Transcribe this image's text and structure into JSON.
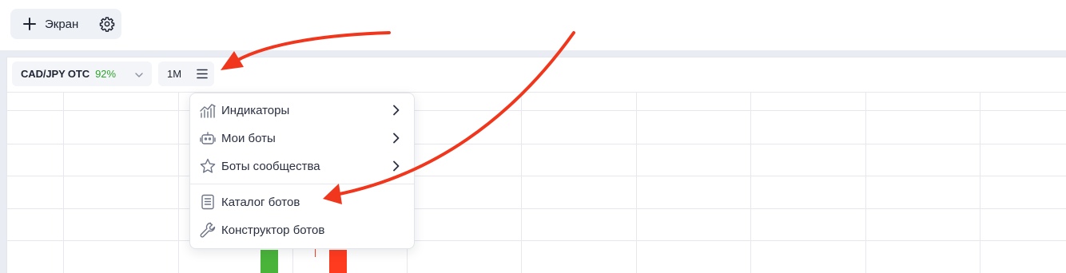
{
  "top": {
    "screen_button_label": "Экран",
    "icons": [
      "plus-icon",
      "gear-icon"
    ]
  },
  "toolbar": {
    "asset_name": "CAD/JPY OTC",
    "asset_payout": "92%",
    "timeframe": "1M"
  },
  "menu": {
    "items": [
      {
        "label": "Индикаторы",
        "icon": "indicators-icon",
        "has_submenu": true
      },
      {
        "label": "Мои боты",
        "icon": "robot-icon",
        "has_submenu": true
      },
      {
        "label": "Боты сообщества",
        "icon": "star-icon",
        "has_submenu": true
      },
      {
        "label": "Каталог ботов",
        "icon": "book-icon",
        "has_submenu": false
      },
      {
        "label": "Конструктор ботов",
        "icon": "wrench-icon",
        "has_submenu": false
      }
    ]
  },
  "colors": {
    "accent_green": "#2ea32e",
    "candle_up": "#49b33a",
    "candle_down": "#ff3b1f",
    "annotation_arrow": "#f0361c"
  }
}
